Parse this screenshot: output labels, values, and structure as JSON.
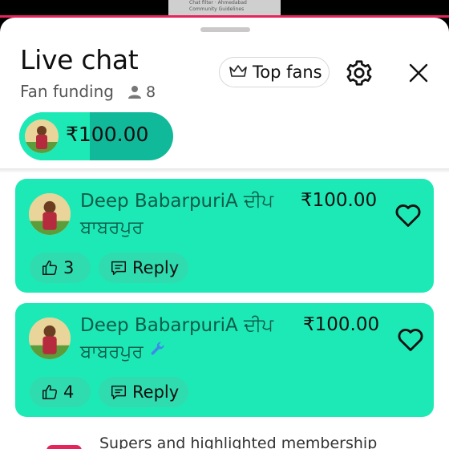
{
  "video": {
    "caption_line1": "Chat filter · Ahmedabad",
    "caption_line2": "Community Guidelines"
  },
  "header": {
    "title": "Live chat",
    "subtitle": "Fan funding",
    "viewer_count": "8",
    "top_fans_label": "Top fans"
  },
  "funding_pill": {
    "amount": "₹100.00",
    "progress_percent": 46
  },
  "messages": [
    {
      "author": "Deep BabarpuriA ਦੀਪ ਬਾਬਰਪੁਰ",
      "amount": "₹100.00",
      "likes": "3",
      "reply_label": "Reply",
      "has_wrench": false
    },
    {
      "author": "Deep BabarpuriA ਦੀਪ ਬਾਬਰਪੁਰ",
      "amount": "₹100.00",
      "likes": "4",
      "reply_label": "Reply",
      "has_wrench": true
    }
  ],
  "footer": {
    "text": "Supers and highlighted membership"
  },
  "colors": {
    "card": "#1de9b6",
    "accent_red": "#e5245a",
    "wrench": "#3a8ce6"
  }
}
